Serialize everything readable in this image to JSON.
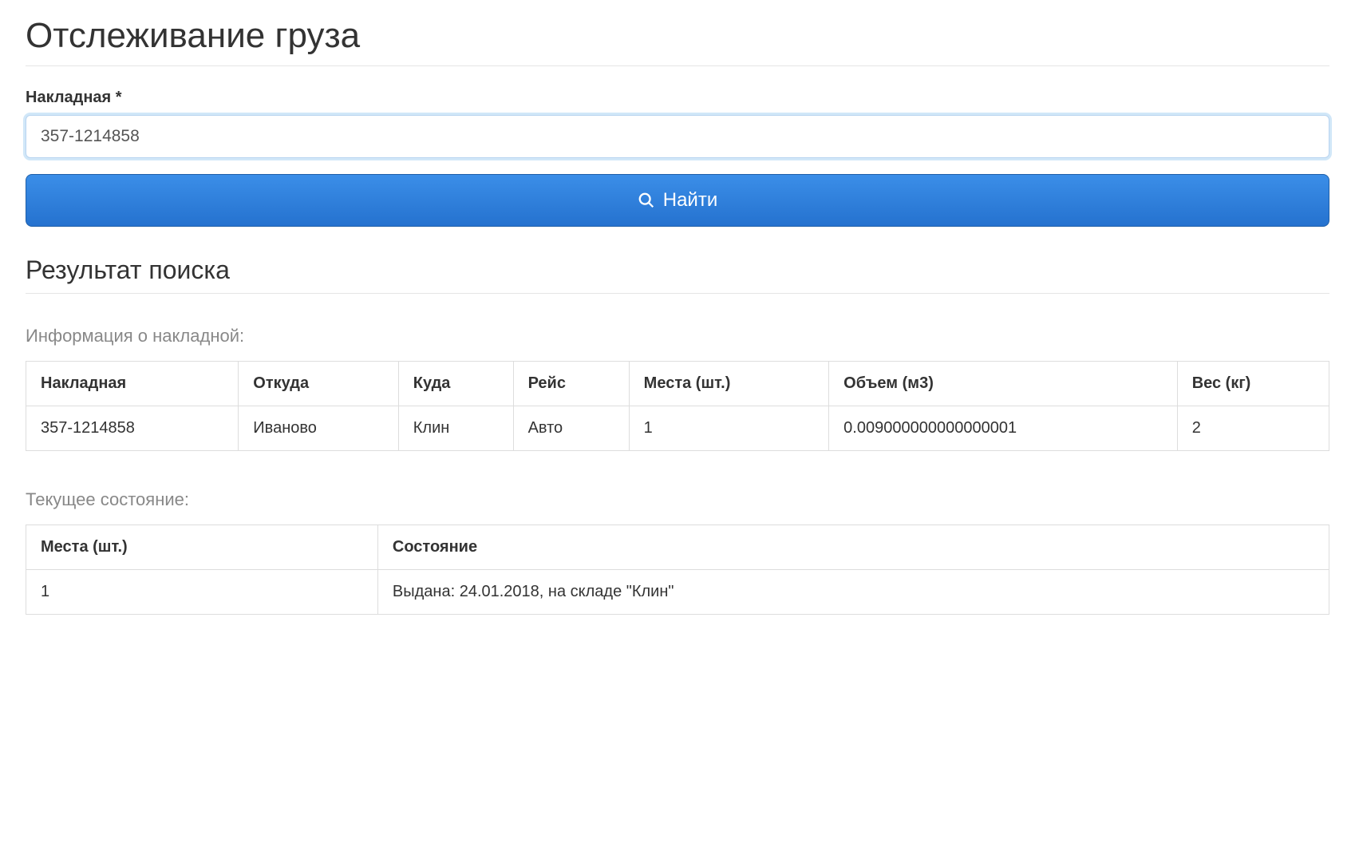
{
  "page": {
    "title": "Отслеживание груза"
  },
  "form": {
    "label": "Накладная *",
    "value": "357-1214858",
    "submit_label": "Найти"
  },
  "results": {
    "heading": "Результат поиска",
    "info_heading": "Информация о накладной:",
    "info_table": {
      "headers": {
        "waybill": "Накладная",
        "from": "Откуда",
        "to": "Куда",
        "route": "Рейс",
        "places": "Места (шт.)",
        "volume": "Объем (м3)",
        "weight": "Вес (кг)"
      },
      "row": {
        "waybill": "357-1214858",
        "from": "Иваново",
        "to": "Клин",
        "route": "Авто",
        "places": "1",
        "volume": "0.009000000000000001",
        "weight": "2"
      }
    },
    "status_heading": "Текущее состояние:",
    "status_table": {
      "headers": {
        "places": "Места (шт.)",
        "state": "Состояние"
      },
      "row": {
        "places": "1",
        "state": "Выдана: 24.01.2018, на складе \"Клин\""
      }
    }
  }
}
